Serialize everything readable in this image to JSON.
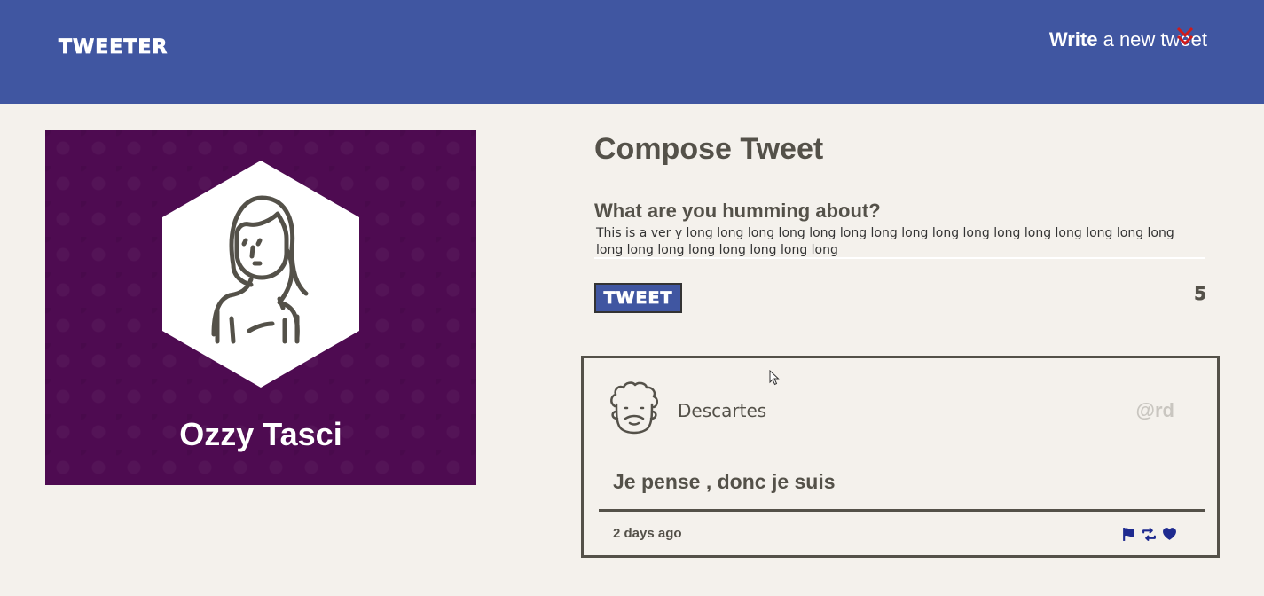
{
  "nav": {
    "logo": "TWEETER",
    "write_bold": "Write",
    "write_rest": " a new tweet",
    "chevron_icon": "double-chevron-down-icon",
    "chevron_color": "#d01a1a",
    "background": "#4056a1"
  },
  "profile": {
    "name": "Ozzy Tasci",
    "avatar_icon": "woman-avatar-icon",
    "background": "#4e0b51"
  },
  "compose": {
    "title": "Compose Tweet",
    "label": "What are you humming about?",
    "input_value": "This is a ver y long long long long long long long long long long long long long long long long long long long long long long long long",
    "button_label": "TWEET",
    "counter": "5"
  },
  "tweet": {
    "avatar_icon": "bearded-man-avatar-icon",
    "name": "Descartes",
    "handle": "@rd",
    "content": "Je pense , donc je suis",
    "date": "2 days ago",
    "actions": [
      "flag-icon",
      "retweet-icon",
      "heart-icon"
    ],
    "action_color": "#1e2a8f"
  }
}
